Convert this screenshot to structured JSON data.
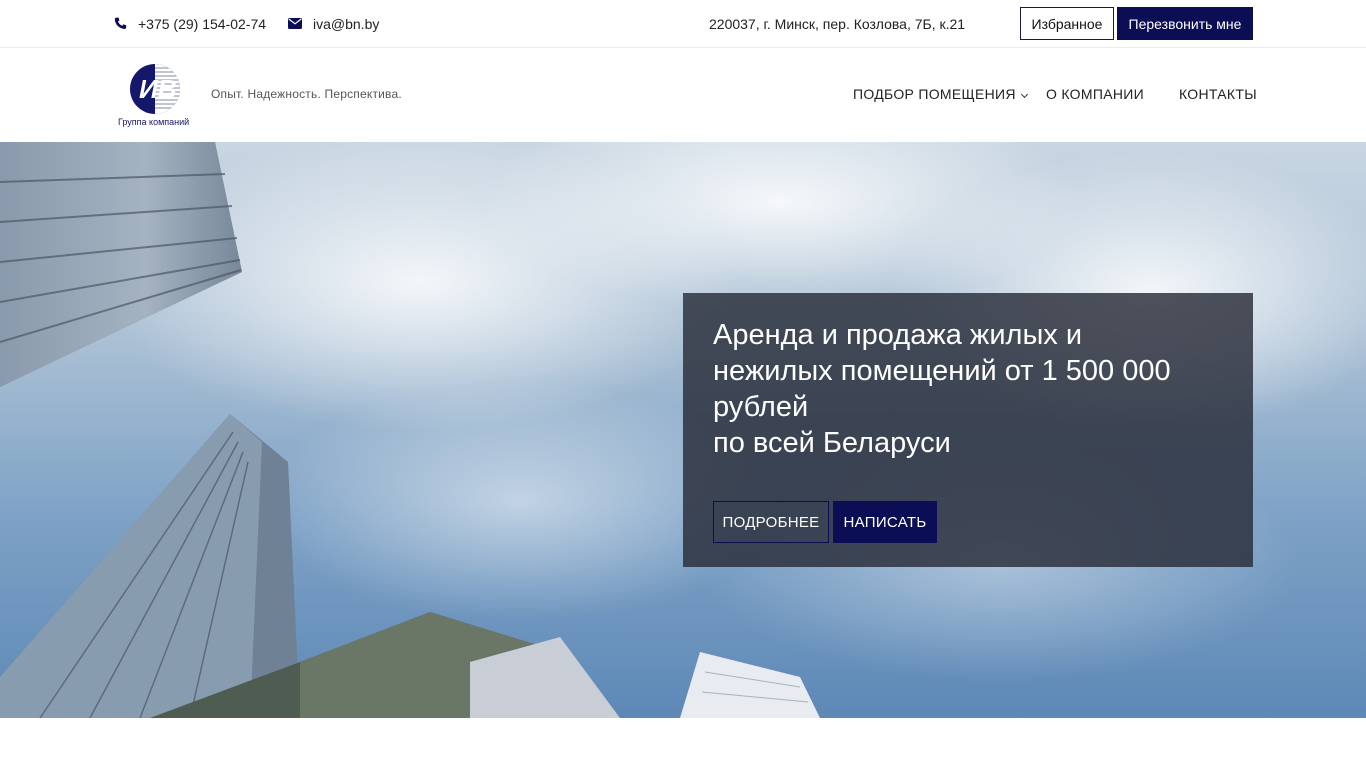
{
  "topbar": {
    "phone": "+375 (29) 154-02-74",
    "phone_icon": "phone-icon",
    "email": "iva@bn.by",
    "email_icon": "envelope-icon",
    "address": "220037, г. Минск, пер. Козлова, 7Б, к.21",
    "favorites_label": "Избранное",
    "callback_label": "Перезвонить мне"
  },
  "header": {
    "logo_text": "ИВ",
    "logo_caption": "Группа компаний",
    "tagline": "Опыт. Надежность. Перспектива.",
    "nav": [
      {
        "label": "ПОДБОР ПОМЕЩЕНИЯ"
      },
      {
        "label": "О КОМПАНИИ"
      },
      {
        "label": "КОНТАКТЫ"
      }
    ]
  },
  "hero": {
    "title_lines": [
      "Аренда и продажа жилых и",
      "нежилых помещений от 1 500 000",
      "рублей",
      "по всей Беларуси"
    ],
    "more_label": "ПОДРОБНЕЕ",
    "write_label": "НАПИСАТЬ"
  },
  "colors": {
    "brand_navy": "#0c0e55",
    "panel_bg": "#2c303c"
  }
}
